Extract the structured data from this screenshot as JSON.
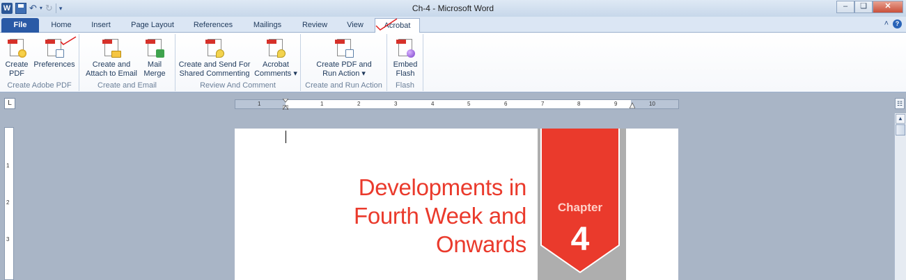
{
  "window": {
    "title": "Ch-4  -  Microsoft Word",
    "minimize": "–",
    "restore": "❏",
    "close": "✕"
  },
  "qat": {
    "word_icon": "W",
    "undo": "↶",
    "redo": "↻",
    "customize": "▾"
  },
  "tabs": {
    "file": "File",
    "home": "Home",
    "insert": "Insert",
    "page_layout": "Page Layout",
    "references": "References",
    "mailings": "Mailings",
    "review": "Review",
    "view": "View",
    "acrobat": "Acrobat"
  },
  "tabrow_right": {
    "collapse": "˄",
    "help": "?"
  },
  "ribbon": {
    "groups": {
      "create_pdf": "Create Adobe PDF",
      "create_email": "Create and Email",
      "review": "Review And Comment",
      "run_action": "Create and Run Action",
      "flash": "Flash"
    },
    "buttons": {
      "create_pdf_1": "Create",
      "create_pdf_2": "PDF",
      "preferences": "Preferences",
      "attach_1": "Create and",
      "attach_2": "Attach to Email",
      "mail_merge_1": "Mail",
      "mail_merge_2": "Merge",
      "shared_1": "Create and Send For",
      "shared_2": "Shared Commenting",
      "acrobat_comments_1": "Acrobat",
      "acrobat_comments_2": "Comments ▾",
      "run_action_1": "Create PDF and",
      "run_action_2": "Run Action ▾",
      "embed_flash_1": "Embed",
      "embed_flash_2": "Flash"
    }
  },
  "ruler": {
    "tab_selector": "L",
    "view_ruler": "☷",
    "numbers": [
      "1",
      "1",
      "2",
      "3",
      "4",
      "5",
      "6",
      "7",
      "8",
      "9",
      "10"
    ]
  },
  "vruler": {
    "numbers": [
      "1",
      "2",
      "3"
    ]
  },
  "scrollbar": {
    "up": "▲"
  },
  "document": {
    "heading_line1": "Developments in",
    "heading_line2": "Fourth Week and",
    "heading_line3": "Onwards",
    "chapter_label": "Chapter",
    "chapter_number": "4"
  },
  "colors": {
    "accent_red": "#ea3a2c",
    "file_tab": "#2a5aa6",
    "banner_gray": "#aeaeae"
  }
}
